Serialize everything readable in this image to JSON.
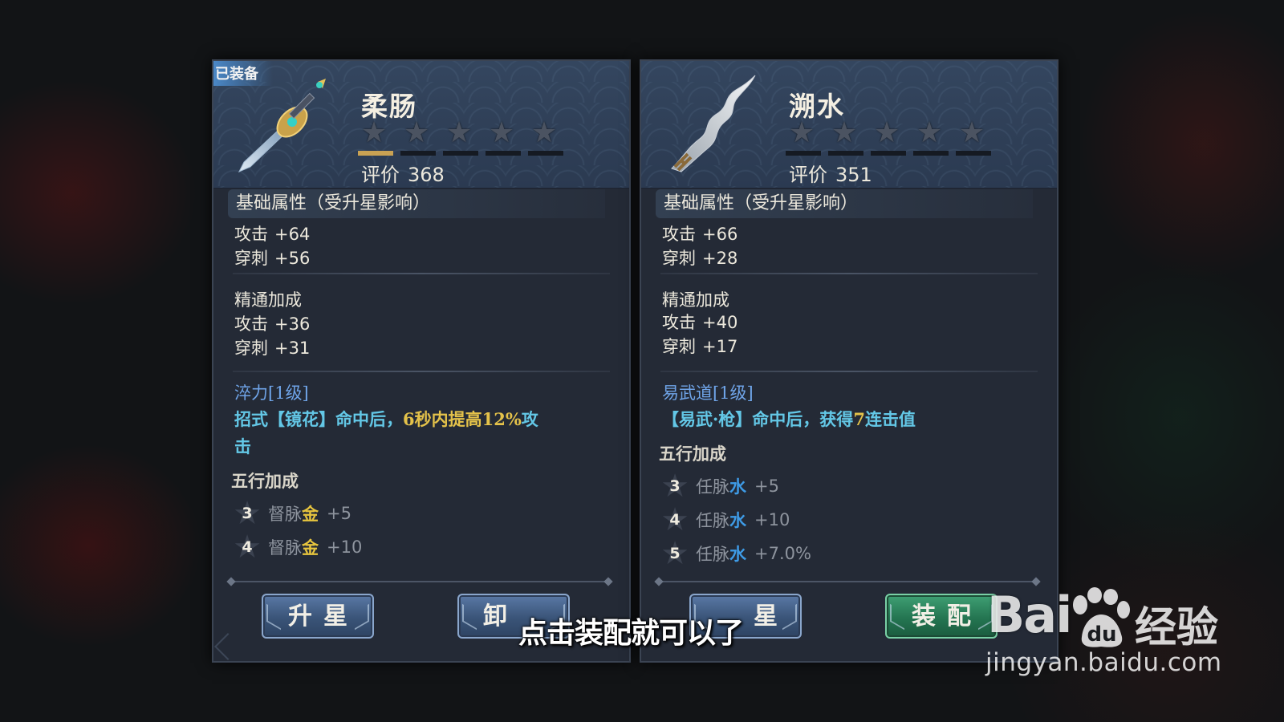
{
  "left_panel": {
    "badge": "已装备",
    "name": "柔肠",
    "stars": 5,
    "stars_lit": 1,
    "rating_label": "评价",
    "rating_value": "368",
    "base_title": "基础属性（受升星影响）",
    "base_stats": [
      {
        "label": "攻击",
        "value": "+64"
      },
      {
        "label": "穿刺",
        "value": "+56"
      }
    ],
    "mastery_title": "精通加成",
    "mastery_stats": [
      {
        "label": "攻击",
        "value": "+36"
      },
      {
        "label": "穿刺",
        "value": "+31"
      }
    ],
    "skill_title": "淬力[1级]",
    "skill_desc_1": "招式【镜花】命中后，",
    "skill_desc_hl": "6秒内提高12%",
    "skill_desc_2": "攻",
    "skill_desc_3": "击",
    "wuxing_title": "五行加成",
    "wuxing_rows": [
      {
        "level": "3",
        "meridian": "督脉",
        "element": "金",
        "value": "+5"
      },
      {
        "level": "4",
        "meridian": "督脉",
        "element": "金",
        "value": "+10"
      }
    ],
    "buttons": {
      "upgrade": "升星",
      "unequip": "卸"
    }
  },
  "right_panel": {
    "name": "溯水",
    "stars": 5,
    "stars_lit": 0,
    "rating_label": "评价",
    "rating_value": "351",
    "base_title": "基础属性（受升星影响）",
    "base_stats": [
      {
        "label": "攻击",
        "value": "+66"
      },
      {
        "label": "穿刺",
        "value": "+28"
      }
    ],
    "mastery_title": "精通加成",
    "mastery_stats": [
      {
        "label": "攻击",
        "value": "+40"
      },
      {
        "label": "穿刺",
        "value": "+17"
      }
    ],
    "skill_title": "易武道[1级]",
    "skill_desc_1": "【易武·枪】命中后，获得",
    "skill_desc_hl": "7",
    "skill_desc_2": "连击值",
    "wuxing_title": "五行加成",
    "wuxing_rows": [
      {
        "level": "3",
        "meridian": "任脉",
        "element": "水",
        "value": "+5"
      },
      {
        "level": "4",
        "meridian": "任脉",
        "element": "水",
        "value": "+10"
      },
      {
        "level": "5",
        "meridian": "任脉",
        "element": "水",
        "value": "+7.0%"
      }
    ],
    "buttons": {
      "upgrade": "星",
      "equip": "装配"
    }
  },
  "subtitle": "点击装配就可以了",
  "watermark": {
    "logo": "Bai",
    "logo_du": "du",
    "cn": "经验",
    "url": "jingyan.baidu.com"
  },
  "colors": {
    "panel_bg": "#242a36",
    "header_bg": "#2f3f57",
    "skill_title": "#6fa4e8",
    "skill_desc": "#63c7e6",
    "highlight": "#e4c24a",
    "metal_gold": "#e6c43e",
    "water_blue": "#3e9be6",
    "star_lit": "#c9a253"
  }
}
